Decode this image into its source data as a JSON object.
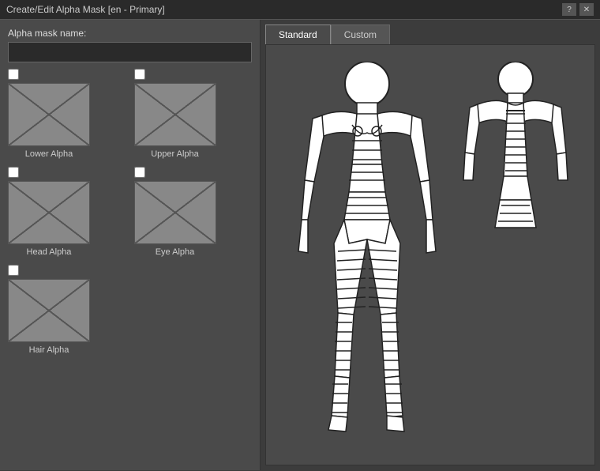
{
  "title": "Create/Edit Alpha Mask [en - Primary]",
  "header": {
    "alpha_mask_label": "Alpha mask name:",
    "alpha_mask_value": ""
  },
  "tabs": [
    {
      "id": "standard",
      "label": "Standard",
      "active": true
    },
    {
      "id": "custom",
      "label": "Custom",
      "active": false
    }
  ],
  "masks": [
    {
      "id": "lower-alpha",
      "label": "Lower Alpha",
      "checked": false
    },
    {
      "id": "upper-alpha",
      "label": "Upper Alpha",
      "checked": false
    },
    {
      "id": "head-alpha",
      "label": "Head Alpha",
      "checked": false
    },
    {
      "id": "eye-alpha",
      "label": "Eye Alpha",
      "checked": false
    },
    {
      "id": "hair-alpha",
      "label": "Hair Alpha",
      "checked": false
    }
  ],
  "buttons": {
    "help": "?",
    "close": "✕"
  }
}
